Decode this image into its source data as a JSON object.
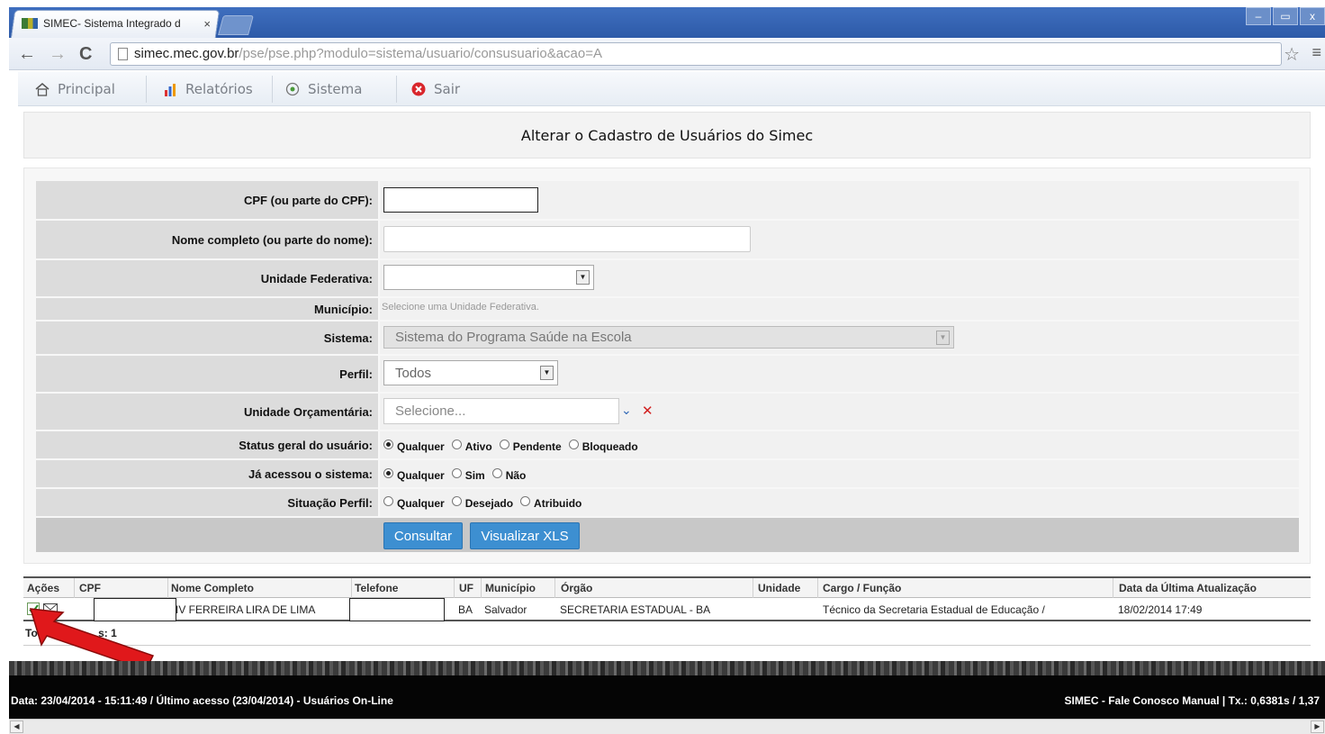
{
  "browser": {
    "tab_title": "SIMEC- Sistema Integrado d",
    "tab_close": "×",
    "url_host": "simec.mec.gov.br",
    "url_path": "/pse/pse.php?modulo=sistema/usuario/consusuario&acao=A",
    "back": "←",
    "forward": "→",
    "reload": "C",
    "star": "☆",
    "menu": "≡",
    "win_min": "–",
    "win_max": "▭",
    "win_close": "x"
  },
  "appmenu": {
    "items": [
      {
        "label": "Principal",
        "icon": "home-icon"
      },
      {
        "label": "Relatórios",
        "icon": "reports-icon"
      },
      {
        "label": "Sistema",
        "icon": "system-icon"
      },
      {
        "label": "Sair",
        "icon": "exit-icon"
      }
    ]
  },
  "page": {
    "title": "Alterar o Cadastro de Usuários do Simec"
  },
  "form": {
    "cpf_label": "CPF (ou parte do CPF):",
    "cpf_value": "",
    "nome_label": "Nome completo (ou parte do nome):",
    "nome_value": "",
    "uf_label": "Unidade Federativa:",
    "uf_value": "",
    "municipio_label": "Município:",
    "municipio_hint": "Selecione uma Unidade Federativa.",
    "sistema_label": "Sistema:",
    "sistema_value": "Sistema do Programa Saúde na Escola",
    "perfil_label": "Perfil:",
    "perfil_value": "Todos",
    "unidade_label": "Unidade Orçamentária:",
    "unidade_placeholder": "Selecione...",
    "status_label": "Status geral do usuário:",
    "status_options": [
      "Qualquer",
      "Ativo",
      "Pendente",
      "Bloqueado"
    ],
    "status_selected": "Qualquer",
    "acessou_label": "Já acessou o sistema:",
    "acessou_options": [
      "Qualquer",
      "Sim",
      "Não"
    ],
    "acessou_selected": "Qualquer",
    "situacao_label": "Situação Perfil:",
    "situacao_options": [
      "Qualquer",
      "Desejado",
      "Atribuido"
    ],
    "situacao_selected": "",
    "btn_consultar": "Consultar",
    "btn_xls": "Visualizar XLS"
  },
  "table": {
    "headers": [
      "Ações",
      "CPF",
      "Nome Completo",
      "Telefone",
      "UF",
      "Município",
      "Órgão",
      "Unidade",
      "Cargo / Função",
      "Data da Última Atualização"
    ],
    "row": {
      "cpf": "",
      "nome": "IV FERREIRA LIRA DE LIMA",
      "telefone": "",
      "uf": "BA",
      "municipio": "Salvador",
      "orgao": "SECRETARIA ESTADUAL - BA",
      "unidade": "",
      "cargo": "Técnico da Secretaria Estadual de Educação /",
      "data": "18/02/2014 17:49"
    },
    "total_left": "Tot",
    "total_right": "s: 1"
  },
  "footer": {
    "left": "Data: 23/04/2014 - 15:11:49 / Último acesso (23/04/2014) - Usuários On-Line",
    "right": "SIMEC - Fale Conosco Manual    | Tx.: 0,6381s / 1,37"
  },
  "colors": {
    "button_blue": "#3d8fd1",
    "label_bg": "#dcdcdc",
    "arrow_red": "#e0181b"
  }
}
